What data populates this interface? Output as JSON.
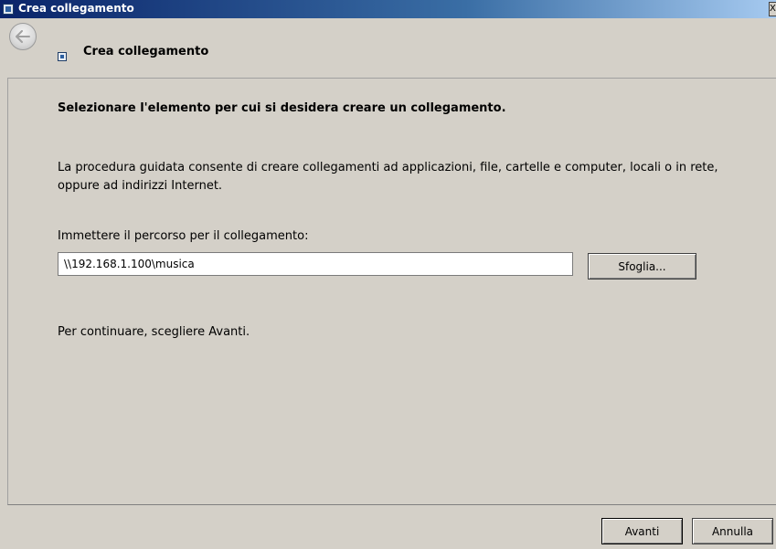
{
  "window": {
    "title": "Crea collegamento",
    "close_glyph": "X"
  },
  "header": {
    "wizard_title": "Crea collegamento",
    "back_icon": "back-arrow-icon"
  },
  "content": {
    "heading": "Selezionare l'elemento per cui si desidera creare un collegamento.",
    "description": "La procedura guidata consente di creare collegamenti ad applicazioni, file, cartelle e computer, locali o in rete, oppure ad indirizzi Internet.",
    "path_label": "Immettere il percorso per il collegamento:",
    "path_value": "\\\\192.168.1.100\\musica",
    "browse_label": "Sfoglia...",
    "continue_note": "Per continuare, scegliere Avanti."
  },
  "footer": {
    "next_label": "Avanti",
    "cancel_label": "Annulla"
  },
  "colors": {
    "titlebar_start": "#0a246a",
    "titlebar_end": "#a6caf0",
    "face": "#d4d0c8"
  }
}
